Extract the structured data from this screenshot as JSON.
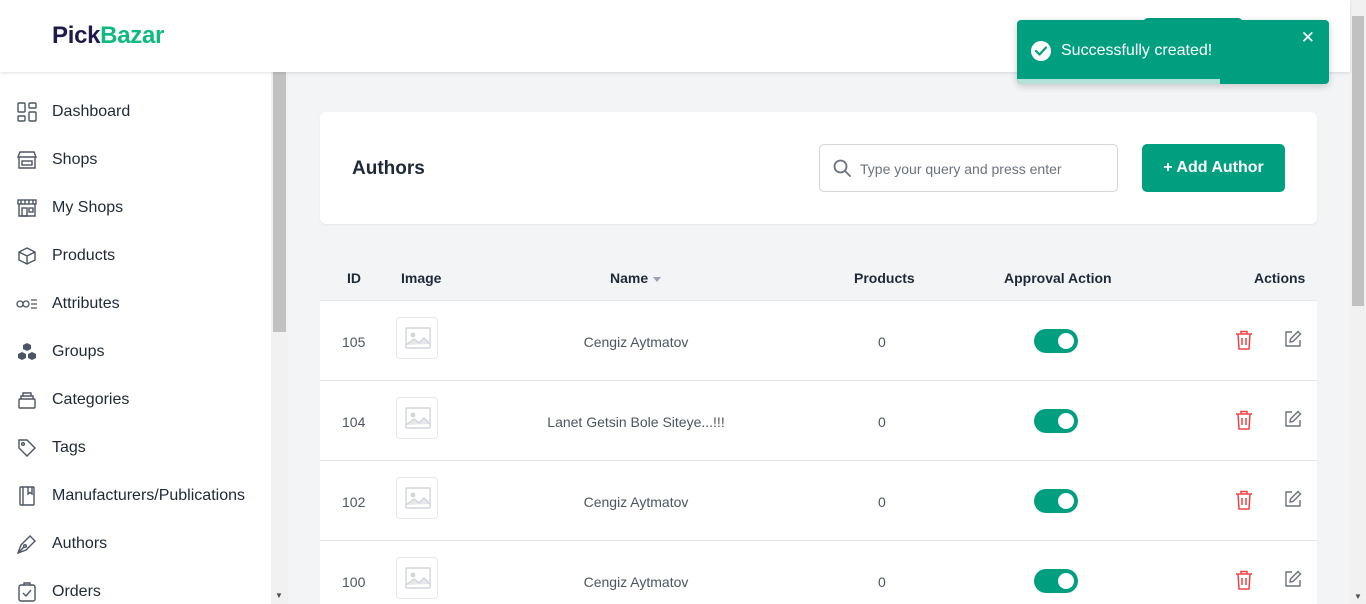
{
  "brand": {
    "part1": "Pick",
    "part2": "Bazar"
  },
  "toast": {
    "message": "Successfully created!",
    "close": "✕",
    "progress_fraction": 0.65
  },
  "sidebar": {
    "items": [
      {
        "label": "Dashboard",
        "icon": "dashboard-icon"
      },
      {
        "label": "Shops",
        "icon": "shop-icon"
      },
      {
        "label": "My Shops",
        "icon": "my-shops-icon"
      },
      {
        "label": "Products",
        "icon": "product-box-icon"
      },
      {
        "label": "Attributes",
        "icon": "attributes-icon"
      },
      {
        "label": "Groups",
        "icon": "groups-icon"
      },
      {
        "label": "Categories",
        "icon": "categories-icon"
      },
      {
        "label": "Tags",
        "icon": "tag-icon"
      },
      {
        "label": "Manufacturers/Publications",
        "icon": "book-icon"
      },
      {
        "label": "Authors",
        "icon": "pen-icon"
      },
      {
        "label": "Orders",
        "icon": "orders-icon"
      }
    ]
  },
  "header_card": {
    "title": "Authors",
    "search_placeholder": "Type your query and press enter",
    "add_button": "+ Add Author"
  },
  "table": {
    "columns": {
      "id": "ID",
      "image": "Image",
      "name": "Name",
      "products": "Products",
      "approval": "Approval Action",
      "actions": "Actions"
    },
    "rows": [
      {
        "id": "105",
        "name": "Cengiz Aytmatov",
        "products": "0",
        "approved": true
      },
      {
        "id": "104",
        "name": "Lanet Getsin Bole Siteye...!!!",
        "products": "0",
        "approved": true
      },
      {
        "id": "102",
        "name": "Cengiz Aytmatov",
        "products": "0",
        "approved": true
      },
      {
        "id": "100",
        "name": "Cengiz Aytmatov",
        "products": "0",
        "approved": true
      }
    ]
  },
  "colors": {
    "accent": "#009f7f",
    "brand_dark": "#1e1b4b",
    "brand_green": "#10b981",
    "delete": "#ef4444"
  }
}
